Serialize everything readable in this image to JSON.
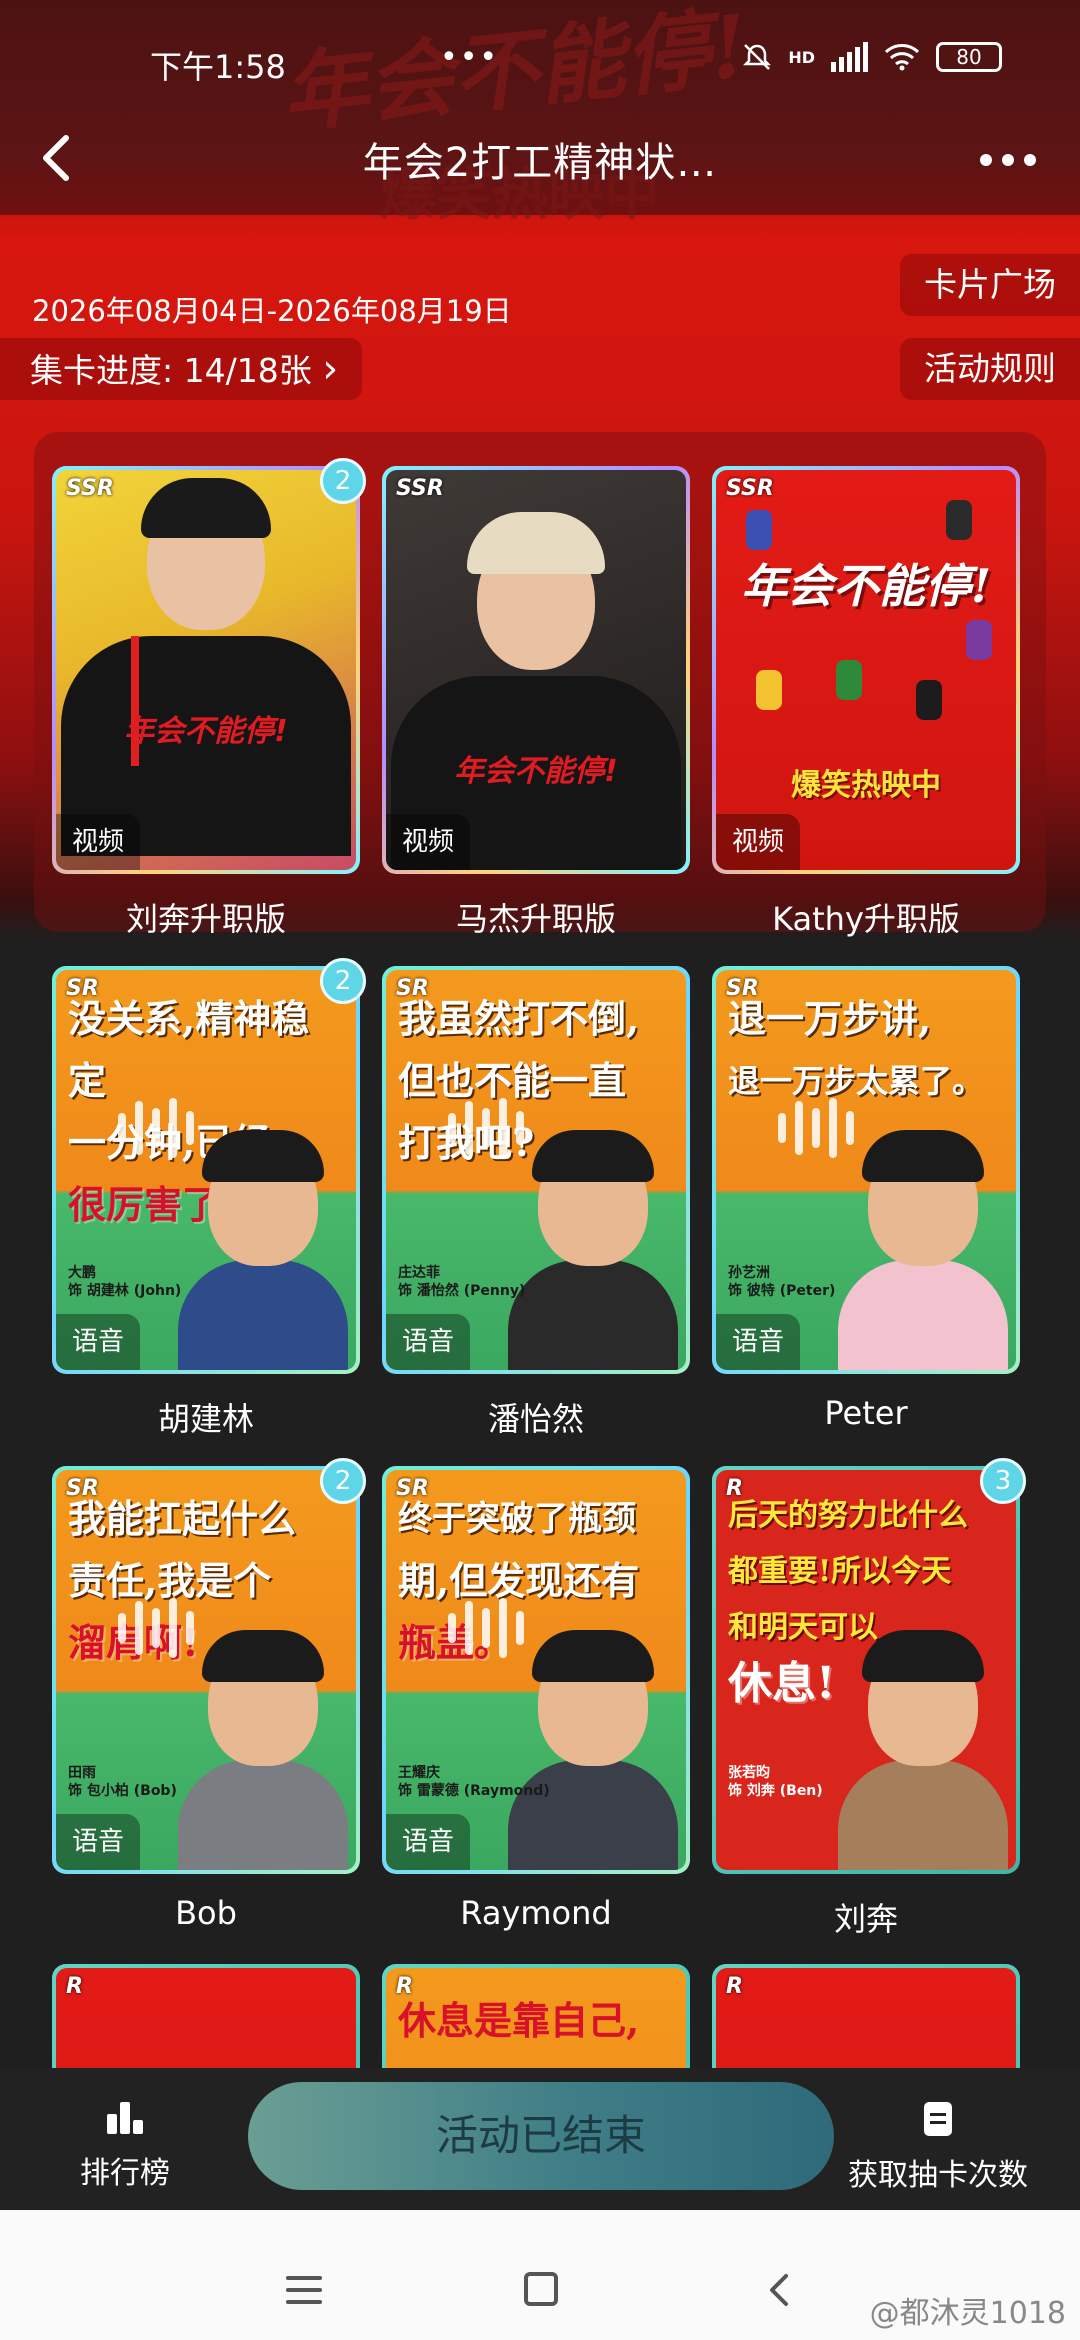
{
  "status_bar": {
    "time": "下午1:58",
    "dots": "•••",
    "network": "HD",
    "battery": "80"
  },
  "nav": {
    "title": "年会2打工精神状…"
  },
  "banner": {
    "art_title": "年会不能停!",
    "art_sub": "爆笑热映中"
  },
  "event": {
    "date_range": "2026年08月04日-2026年08月19日",
    "progress_label": "集卡进度: 14/18张 ",
    "progress_chevron": "›",
    "plaza_button": "卡片广场",
    "rules_button": "活动规则"
  },
  "cards": [
    {
      "tier": "SSR",
      "badge": "2",
      "media": "视频",
      "name": "刘奔升职版",
      "tee_text": "年会不能停!"
    },
    {
      "tier": "SSR",
      "badge": "",
      "media": "视频",
      "name": "马杰升职版",
      "tee_text": "年会不能停!"
    },
    {
      "tier": "SSR",
      "badge": "",
      "media": "视频",
      "name": "Kathy升职版",
      "poster_title": "年会不能停!",
      "poster_sub": "爆笑热映中"
    },
    {
      "tier": "SR",
      "badge": "2",
      "media": "语音",
      "name": "胡建林",
      "quote_lines": [
        "没关系,精神稳定",
        "一分钟,已经",
        "很厉害了。"
      ],
      "credit": [
        "大鹏",
        "饰 胡建林 (John)"
      ]
    },
    {
      "tier": "SR",
      "badge": "",
      "media": "语音",
      "name": "潘怡然",
      "quote_lines": [
        "我虽然打不倒,",
        "但也不能一直",
        "打我吧?"
      ],
      "credit": [
        "庄达菲",
        "饰 潘怡然 (Penny)"
      ]
    },
    {
      "tier": "SR",
      "badge": "",
      "media": "语音",
      "name": "Peter",
      "quote_lines": [
        "退一万步讲,",
        "退一万步太累了。"
      ],
      "credit": [
        "孙艺洲",
        "饰 彼特 (Peter)"
      ]
    },
    {
      "tier": "SR",
      "badge": "2",
      "media": "语音",
      "name": "Bob",
      "quote_lines": [
        "我能扛起什么",
        "责任,我是个",
        "溜肩啊!"
      ],
      "credit": [
        "田雨",
        "饰 包小柏 (Bob)"
      ]
    },
    {
      "tier": "SR",
      "badge": "",
      "media": "语音",
      "name": "Raymond",
      "quote_lines": [
        "终于突破了瓶颈",
        "期,但发现还有",
        "瓶盖。"
      ],
      "credit": [
        "王耀庆",
        "饰 雷蒙德 (Raymond)"
      ]
    },
    {
      "tier": "R",
      "badge": "3",
      "media": "",
      "name": "刘奔",
      "quote_lines": [
        "后天的努力比什么",
        "都重要!所以今天",
        "和明天可以",
        "休息!"
      ],
      "credit": [
        "张若昀",
        "饰 刘奔 (Ben)"
      ]
    }
  ],
  "partial_cards": [
    {
      "tier": "R",
      "text": ""
    },
    {
      "tier": "R",
      "text": "休息是靠自己,"
    },
    {
      "tier": "R",
      "text": ""
    }
  ],
  "bottom": {
    "rank_label": "排行榜",
    "ended_label": "活动已结束",
    "draw_label": "获取抽卡次数"
  },
  "watermark": "@都沐灵1018",
  "colors": {
    "banner_red": "#d8170f",
    "accent_teal": "#3f7e87",
    "page_dark": "#1f1f1f"
  }
}
